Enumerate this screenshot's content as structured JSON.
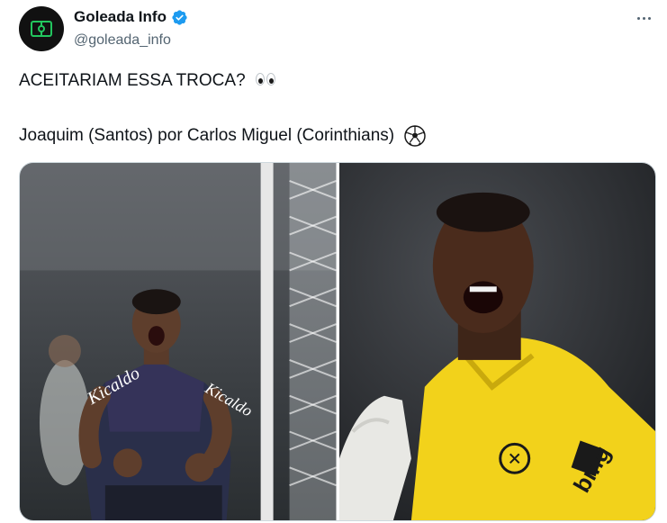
{
  "account": {
    "display_name": "Goleada Info",
    "handle": "@goleada_info",
    "verified": true
  },
  "tweet": {
    "line1": "ACEITARIAM ESSA TROCA?",
    "line1_emoji": "eyes-emoji",
    "line2": "Joaquim (Santos) por Carlos Miguel (Corinthians)",
    "line2_emoji": "soccer-ball-emoji"
  },
  "media": {
    "photo_left": {
      "subject": "player-celebrating",
      "shirt_sponsor_text": "Kicaldo"
    },
    "photo_right": {
      "subject": "goalkeeper-shouting",
      "shirt_sponsor_text": "bmg"
    }
  },
  "colors": {
    "verified_blue": "#1d9bf0",
    "text_primary": "#0f1419",
    "text_secondary": "#536471",
    "border": "#cfd9de",
    "goalkeeper_yellow": "#f2d21b",
    "santos_kit": "#2a2f4a"
  },
  "icons": {
    "more": "more-icon",
    "verified": "verified-badge-icon",
    "avatar": "pitch-logo-icon"
  }
}
